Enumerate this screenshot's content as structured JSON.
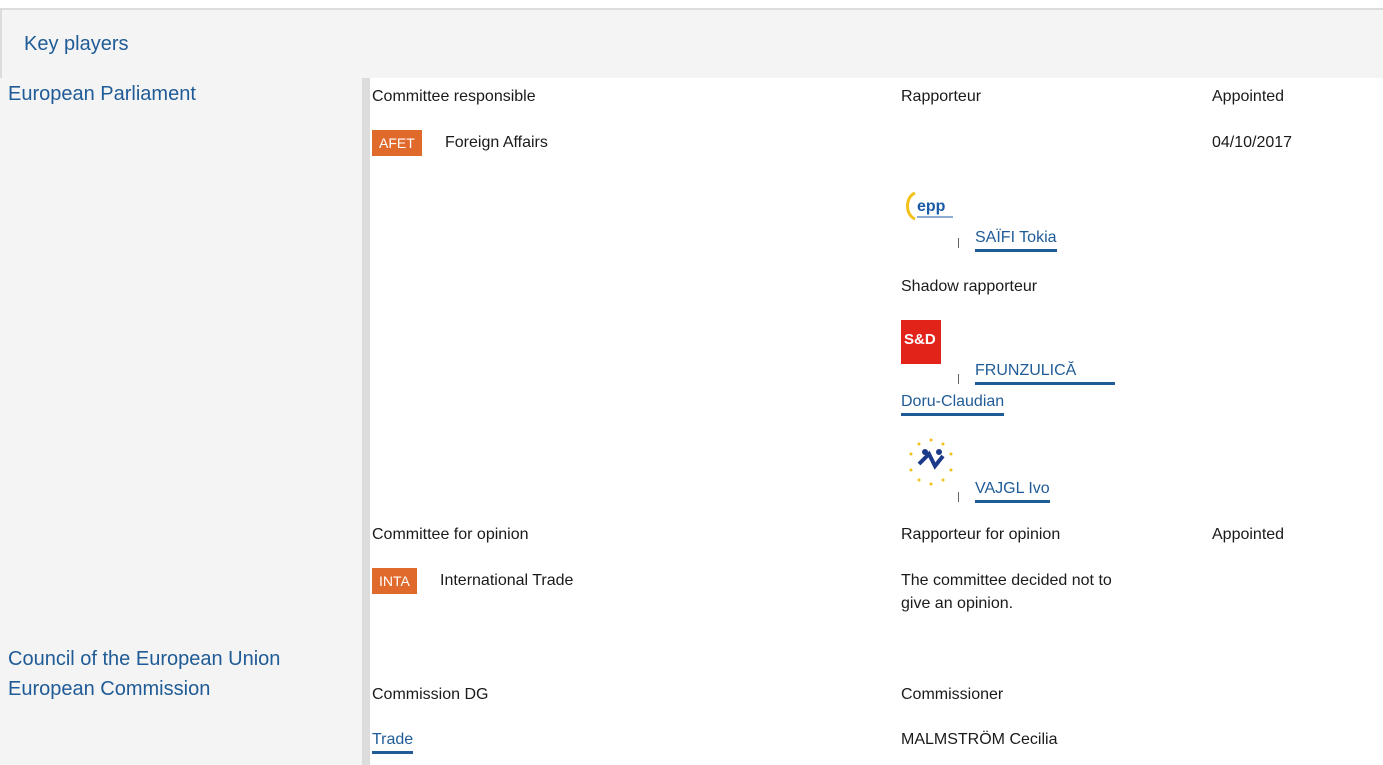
{
  "section": {
    "title": "Key players"
  },
  "institutions": {
    "ep": "European Parliament",
    "council": "Council of the European Union",
    "commission": "European Commission"
  },
  "responsible": {
    "col_committee": "Committee responsible",
    "col_rapporteur": "Rapporteur",
    "col_appointed": "Appointed",
    "committee_code": "AFET",
    "committee_name": "Foreign Affairs",
    "appointed_date": "04/10/2017",
    "rapporteur": {
      "name": "SAÏFI Tokia",
      "group_icon": "epp-logo"
    },
    "shadow_label": "Shadow rapporteur",
    "shadows": [
      {
        "name_line1": "FRUNZULICĂ",
        "name_line2": "Doru-Claudian",
        "group_icon": "sd-logo"
      },
      {
        "name": "VAJGL Ivo",
        "group_icon": "alde-logo"
      }
    ]
  },
  "opinion": {
    "col_committee": "Committee for opinion",
    "col_rapporteur": "Rapporteur for opinion",
    "col_appointed": "Appointed",
    "committee_code": "INTA",
    "committee_name": "International Trade",
    "note_line1": "The committee decided not to",
    "note_line2": "give an opinion."
  },
  "commission": {
    "col_dg": "Commission DG",
    "col_commissioner": "Commissioner",
    "dg": "Trade",
    "commissioner": "MALMSTRÖM Cecilia"
  },
  "colors": {
    "link": "#1f5b96",
    "badge": "#e06a2c",
    "panel": "#f4f4f4",
    "sd_red": "#e2231a"
  }
}
